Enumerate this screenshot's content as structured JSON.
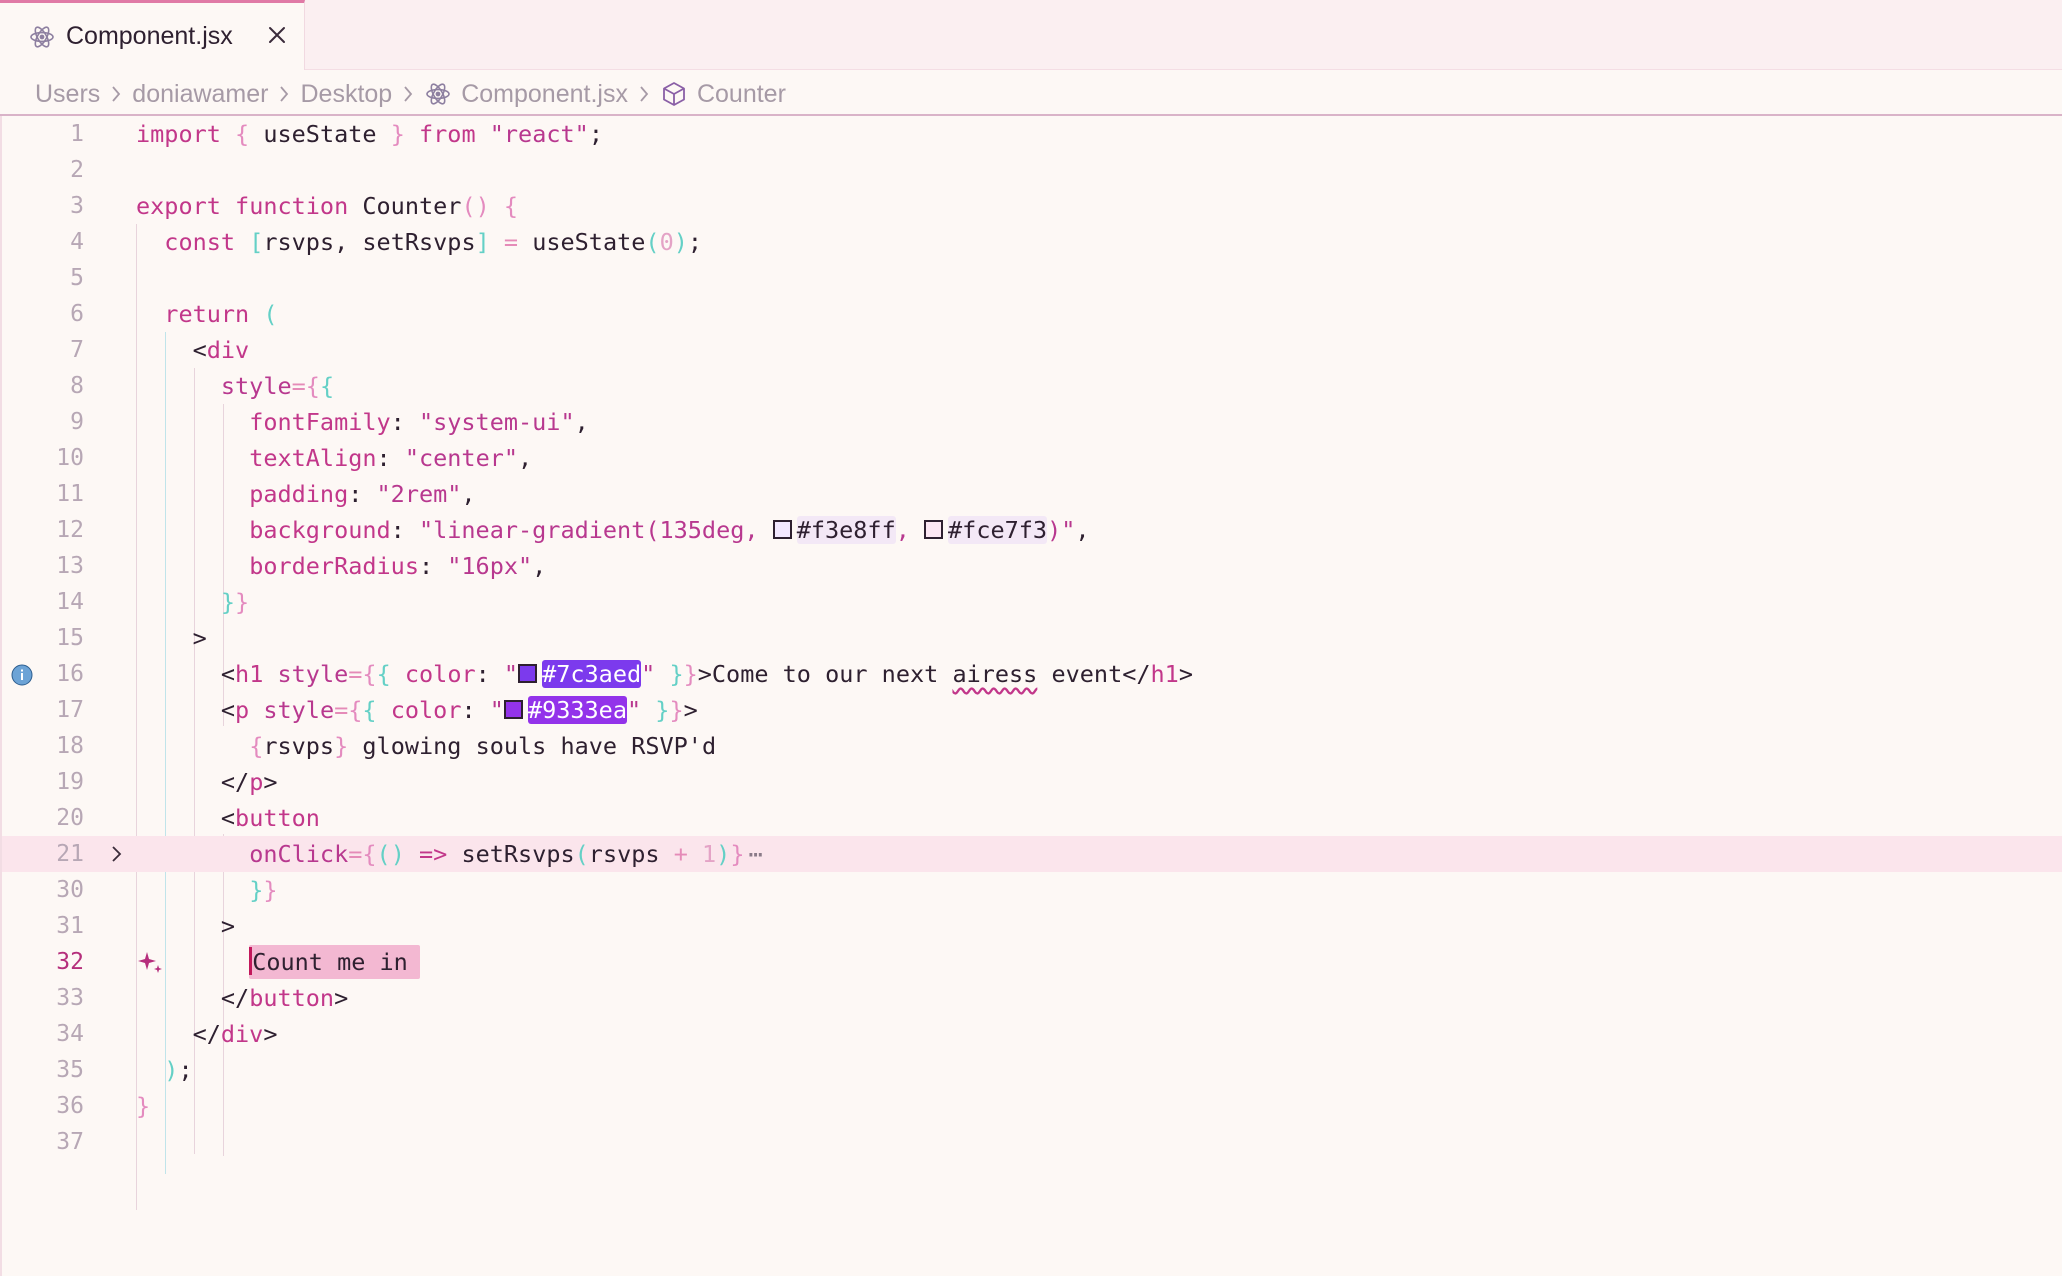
{
  "tab": {
    "label": "Component.jsx"
  },
  "breadcrumb": {
    "items": [
      "Users",
      "doniawamer",
      "Desktop",
      "Component.jsx",
      "Counter"
    ]
  },
  "icons": {
    "tab_file": "react-icon",
    "tab_close": "close-icon",
    "breadcrumb_file": "react-icon",
    "breadcrumb_symbol": "cube-icon",
    "gutter_info": "info-icon",
    "gutter_fold": "chevron-right-icon",
    "gutter_ai": "sparkle-icon"
  },
  "colors": {
    "accent": "#c2378a",
    "swatch_1": "#f3e8ff",
    "swatch_2": "#fce7f3",
    "swatch_3": "#7c3aed",
    "swatch_4": "#9333ea"
  },
  "editor": {
    "current_line": "32",
    "lines": [
      {
        "n": "1",
        "code": "import { useState } from \"react\";"
      },
      {
        "n": "2",
        "code": ""
      },
      {
        "n": "3",
        "code": "export function Counter() {"
      },
      {
        "n": "4",
        "code": "const [rsvps, setRsvps] = useState(0);"
      },
      {
        "n": "5",
        "code": ""
      },
      {
        "n": "6",
        "code": "return ("
      },
      {
        "n": "7",
        "code": "<div"
      },
      {
        "n": "8",
        "code": "style={{"
      },
      {
        "n": "9",
        "code": "fontFamily: \"system-ui\","
      },
      {
        "n": "10",
        "code": "textAlign: \"center\","
      },
      {
        "n": "11",
        "code": "padding: \"2rem\","
      },
      {
        "n": "12",
        "code": "background: \"linear-gradient(135deg, #f3e8ff, #fce7f3)\","
      },
      {
        "n": "13",
        "code": "borderRadius: \"16px\","
      },
      {
        "n": "14",
        "code": "}}"
      },
      {
        "n": "15",
        "code": ">"
      },
      {
        "n": "16",
        "code": "<h1 style={{ color: \"#7c3aed\" }}>Come to our next airess event</h1>"
      },
      {
        "n": "17",
        "code": "<p style={{ color: \"#9333ea\" }}>"
      },
      {
        "n": "18",
        "code": "{rsvps} glowing souls have RSVP'd"
      },
      {
        "n": "19",
        "code": "</p>"
      },
      {
        "n": "20",
        "code": "<button"
      },
      {
        "n": "21",
        "code": "onClick={() => setRsvps(rsvps + 1)}"
      },
      {
        "n": "30",
        "code": "}}"
      },
      {
        "n": "31",
        "code": ">"
      },
      {
        "n": "32",
        "code": "Count me in"
      },
      {
        "n": "33",
        "code": "</button>"
      },
      {
        "n": "34",
        "code": "</div>"
      },
      {
        "n": "35",
        "code": ");"
      },
      {
        "n": "36",
        "code": "}"
      },
      {
        "n": "37",
        "code": ""
      }
    ],
    "tokens": {
      "import": "import",
      "useState": "useState",
      "from": "from",
      "react": "\"react\"",
      "export": "export",
      "function": "function",
      "Counter": "Counter",
      "const": "const",
      "rsvps": "rsvps",
      "setRsvps": "setRsvps",
      "zero": "0",
      "return": "return",
      "div": "div",
      "style": "style",
      "fontFamily": "fontFamily",
      "system_ui": "\"system-ui\"",
      "textAlign": "textAlign",
      "center": "\"center\"",
      "padding": "padding",
      "two_rem": "\"2rem\"",
      "background": "background",
      "lg_open": "\"linear-gradient(135deg, ",
      "hex1": "#f3e8ff",
      "hex2": "#fce7f3",
      "lg_close": ")\"",
      "borderRadius": "borderRadius",
      "sixteen_px": "\"16px\"",
      "h1": "h1",
      "color": "color",
      "hex3": "#7c3aed",
      "h1_text_a": "Come to our next ",
      "airess": "airess",
      "h1_text_b": " event",
      "p": "p",
      "hex4": "#9333ea",
      "rsvp_text": " glowing souls have RSVP'd",
      "button": "button",
      "onClick": "onClick",
      "one": "1",
      "btn_text_first": "C",
      "btn_text_rest": "ount me in"
    }
  }
}
